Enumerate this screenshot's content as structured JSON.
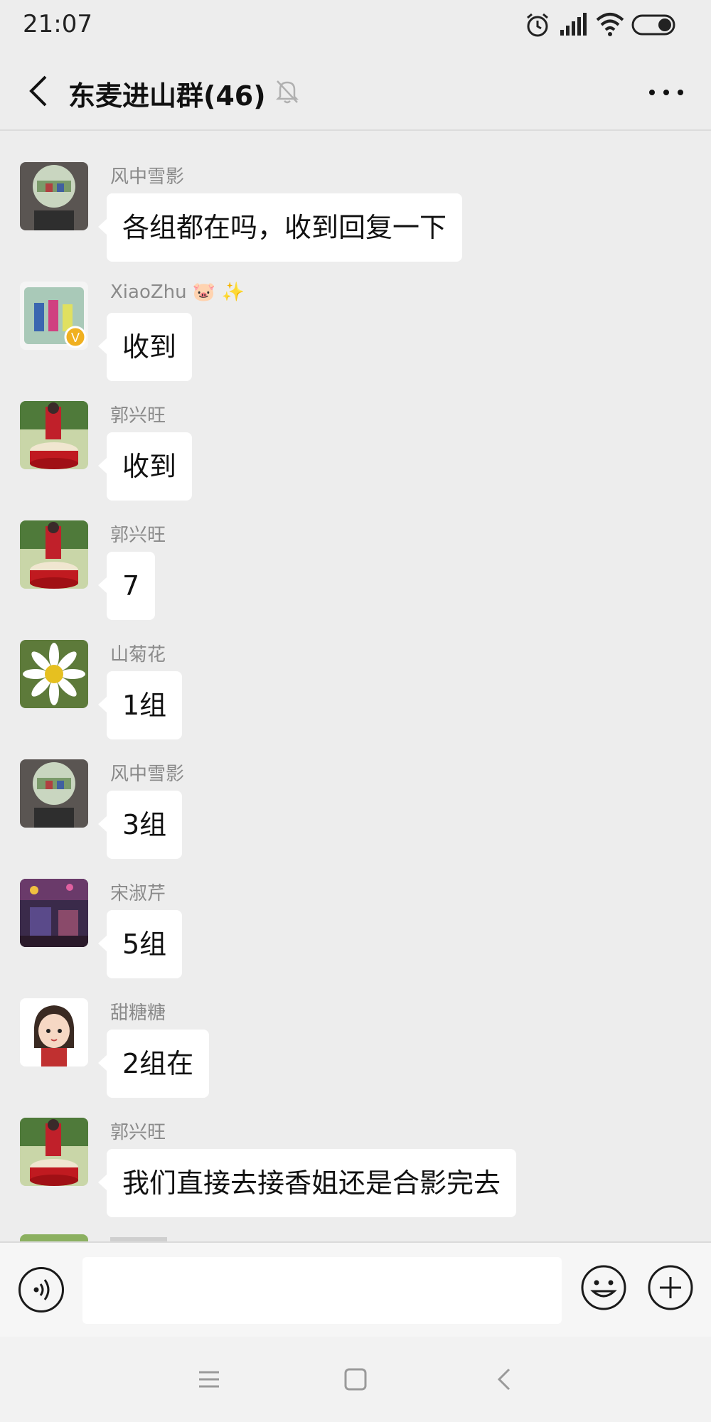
{
  "status": {
    "time": "21:07"
  },
  "header": {
    "title": "东麦进山群(46)"
  },
  "messages": [
    {
      "sender": "风中雪影",
      "text": "各组都在吗，收到回复一下",
      "avatar": "landscape-photo-avatar"
    },
    {
      "sender": "XiaoZhu",
      "sender_emoji": "🐷 ✨",
      "text": "收到",
      "avatar": "group-photo-avatar",
      "verified_badge": "V"
    },
    {
      "sender": "郭兴旺",
      "text": "收到",
      "avatar": "drum-photo-avatar"
    },
    {
      "sender": "郭兴旺",
      "text": "7",
      "avatar": "drum-photo-avatar"
    },
    {
      "sender": "山菊花",
      "text": "1组",
      "avatar": "daisy-photo-avatar"
    },
    {
      "sender": "风中雪影",
      "text": "3组",
      "avatar": "landscape-photo-avatar"
    },
    {
      "sender": "宋淑芹",
      "text": "5组",
      "avatar": "night-scene-avatar"
    },
    {
      "sender": "甜糖糖",
      "text": "2组在",
      "avatar": "cartoon-girl-avatar"
    },
    {
      "sender": "郭兴旺",
      "text": "我们直接去接香姐还是合影完去",
      "avatar": "drum-photo-avatar"
    }
  ],
  "input": {
    "value": "",
    "placeholder": ""
  },
  "colors": {
    "background": "#ededed",
    "bubble": "#ffffff",
    "sender_name": "#8a8a8a",
    "input_bar": "#f6f6f6"
  }
}
